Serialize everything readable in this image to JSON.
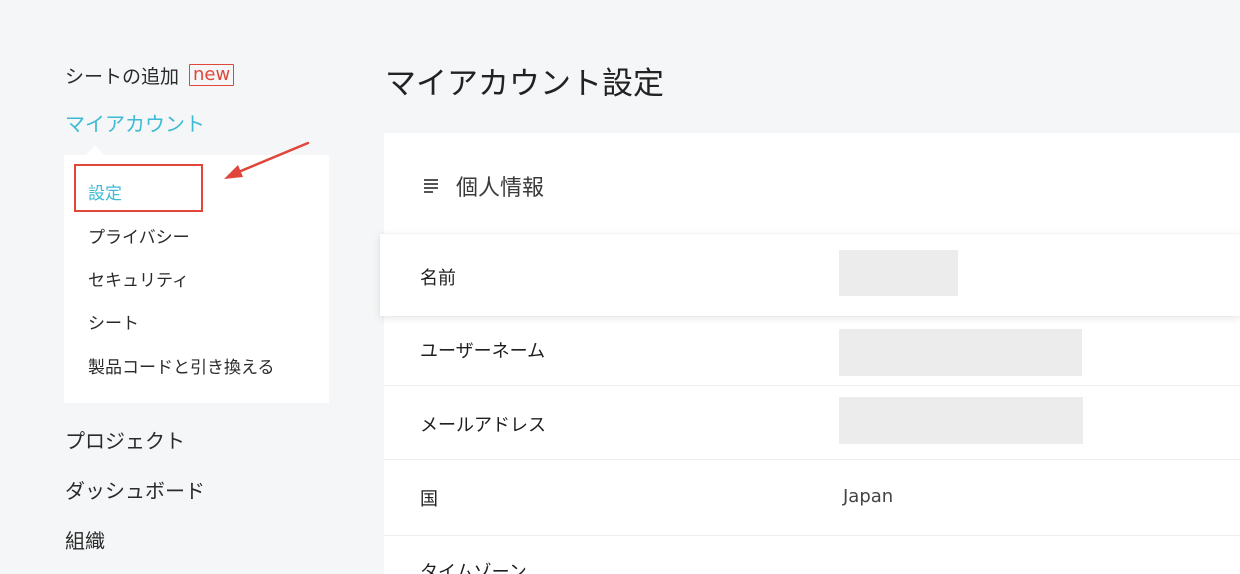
{
  "sidebar": {
    "add_sheet_label": "シートの追加",
    "new_badge": "new",
    "account_label": "マイアカウント",
    "submenu": [
      {
        "label": "設定",
        "active": true
      },
      {
        "label": "プライバシー",
        "active": false
      },
      {
        "label": "セキュリティ",
        "active": false
      },
      {
        "label": "シート",
        "active": false
      },
      {
        "label": "製品コードと引き換える",
        "active": false
      }
    ],
    "nav": [
      {
        "label": "プロジェクト"
      },
      {
        "label": "ダッシュボード"
      },
      {
        "label": "組織"
      }
    ]
  },
  "main": {
    "title": "マイアカウント設定",
    "section_title": "個人情報",
    "section_icon": "list-icon",
    "rows": [
      {
        "label": "名前",
        "value": ""
      },
      {
        "label": "ユーザーネーム",
        "value": ""
      },
      {
        "label": "メールアドレス",
        "value": ""
      },
      {
        "label": "国",
        "value": "Japan"
      },
      {
        "label": "タイムゾーン",
        "value": ""
      }
    ]
  },
  "colors": {
    "accent": "#3dbbd4",
    "annotation_red": "#e0473a",
    "page_bg": "#f5f6f7",
    "placeholder_gray": "#ececec"
  }
}
